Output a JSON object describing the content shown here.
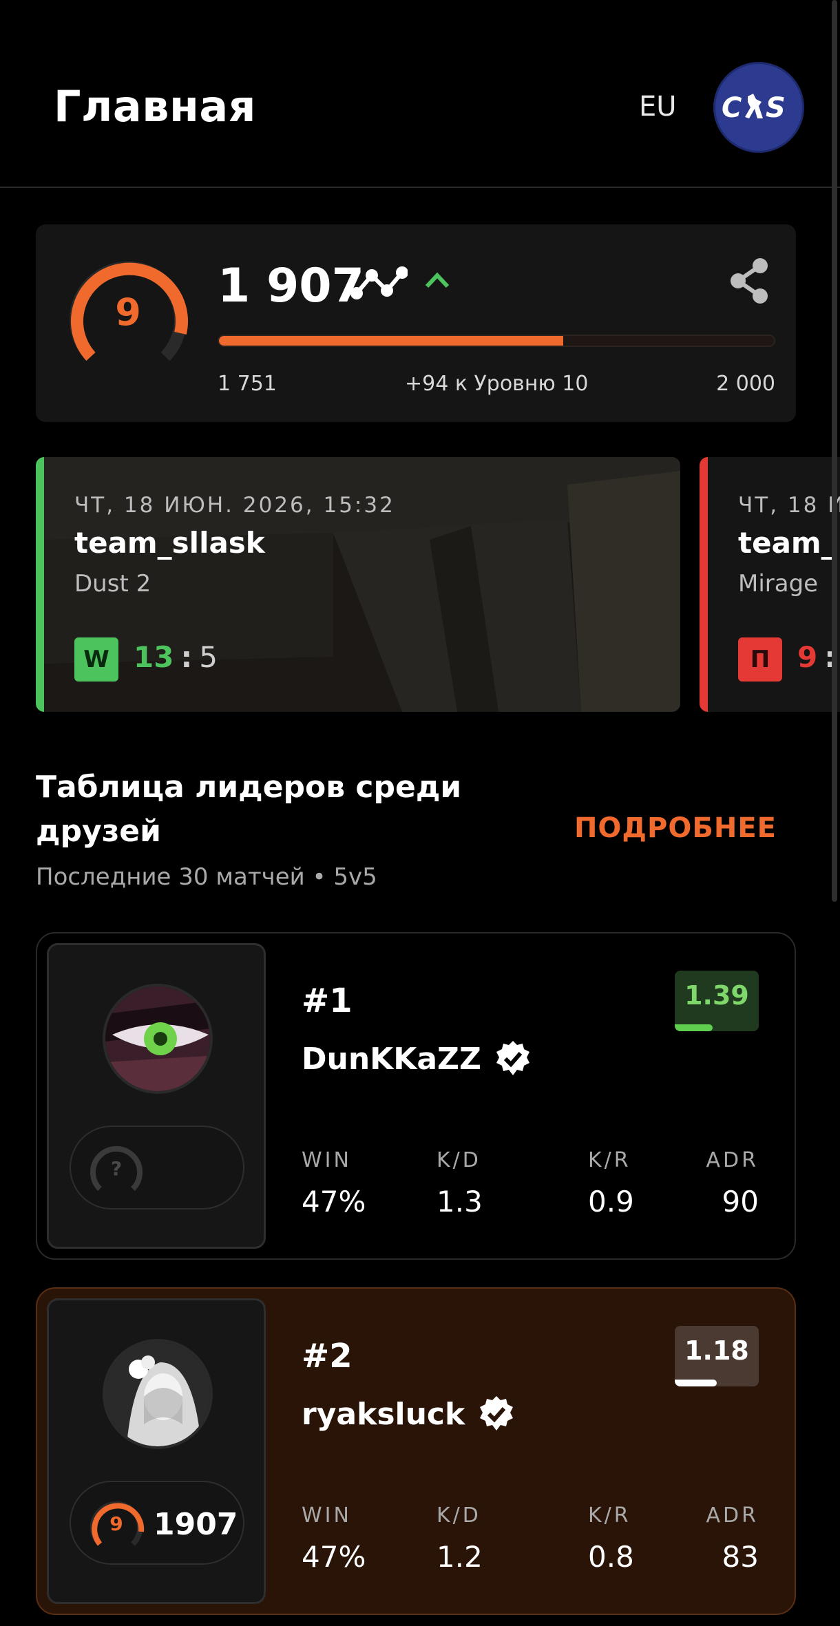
{
  "header": {
    "title": "Главная",
    "region": "EU",
    "game_logo_text": "CS"
  },
  "elo": {
    "level": "9",
    "value": "1 907",
    "min": "1 751",
    "max": "2 000",
    "goal_text": "+94 к Уровню 10",
    "progress": 0.62,
    "trend_icon": "trend-line-icon",
    "direction_icon": "chevron-up-icon",
    "share_icon": "share-icon",
    "accent": "#f06a2e"
  },
  "matches": [
    {
      "date": "ЧТ, 18 ИЮН. 2026, 15:32",
      "team": "team_sllask",
      "map": "Dust 2",
      "result": "W",
      "score_own": "13",
      "score_other": "5",
      "color": "#4cc35c"
    },
    {
      "date": "ЧТ, 18 И",
      "team": "team_",
      "map": "Mirage",
      "result": "П",
      "score_own": "9",
      "score_other": "",
      "color": "#e53935"
    }
  ],
  "leaderboard": {
    "title": "Таблица лидеров среди друзей",
    "subtitle": "Последние 30 матчей • 5v5",
    "more_label": "ПОДРОБНЕЕ",
    "stat_labels": {
      "win": "WIN",
      "kd": "K/D",
      "kr": "K/R",
      "adr": "ADR"
    },
    "players": [
      {
        "rank": "#1",
        "name": "DunKKaZZ",
        "rating": "1.39",
        "rating_fill": 0.45,
        "level": "?",
        "elo": "",
        "win": "47%",
        "kd": "1.3",
        "kr": "0.9",
        "adr": "90"
      },
      {
        "rank": "#2",
        "name": "ryaksluck",
        "rating": "1.18",
        "rating_fill": 0.5,
        "level": "9",
        "elo": "1907",
        "win": "47%",
        "kd": "1.2",
        "kr": "0.8",
        "adr": "83"
      }
    ]
  }
}
